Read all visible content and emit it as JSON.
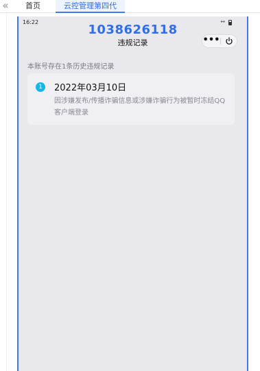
{
  "tabbar": {
    "collapse_glyph": "«",
    "tabs": [
      {
        "label": "首页",
        "active": false
      },
      {
        "label": "云控管理第四代",
        "active": true
      }
    ]
  },
  "device": {
    "status": {
      "time": "16:22",
      "signal_glyph": "↔"
    },
    "header": {
      "qq_number": "1038626118",
      "title": "违规记录",
      "more_glyph": "•••"
    },
    "summary": "本账号存在1条历史违规记录",
    "records": [
      {
        "index": "1",
        "date": "2022年03月10日",
        "description": "因涉嫌发布/传播诈骗信息或涉嫌诈骗行为被暂时冻结QQ客户端登录"
      }
    ]
  },
  "colors": {
    "accent": "#2f6fea",
    "device_border": "#4774ea",
    "badge": "#16b6e6",
    "device_bg": "#e9e8ed"
  },
  "icons": [
    "collapse-icon",
    "signal-icon",
    "battery-icon",
    "more-icon",
    "power-icon"
  ]
}
